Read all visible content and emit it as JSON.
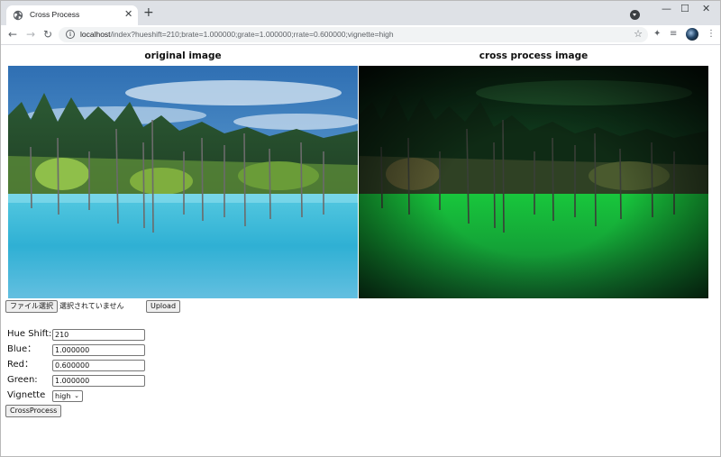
{
  "browser": {
    "tab_title": "Cross Process",
    "tab_close": "✕",
    "new_tab": "+",
    "url_host": "localhost",
    "url_path": "/index?hueshift=210;brate=1.000000;grate=1.000000;rrate=0.600000;vignette=high",
    "minimize": "—",
    "maximize": "☐",
    "close": "✕"
  },
  "page": {
    "original_title": "original image",
    "processed_title": "cross process image",
    "file_select_label": "ファイル選択",
    "no_file_text": "選択されていません",
    "upload_label": "Upload",
    "fields": {
      "hue_label": "Hue Shift:",
      "hue_value": "210",
      "blue_label": "Blue：",
      "blue_value": "1.000000",
      "red_label": "Red：",
      "red_value": "0.600000",
      "green_label": "Green:",
      "green_value": "1.000000",
      "vignette_label": "Vignette",
      "vignette_value": "high"
    },
    "crossprocess_label": "CrossProcess"
  },
  "colors": {
    "tabstrip": "#dee1e6",
    "omnibox": "#f1f3f4",
    "button_bg": "#efefef",
    "accent_green": "#17c23a",
    "water_blue": "#3fb8d6"
  }
}
